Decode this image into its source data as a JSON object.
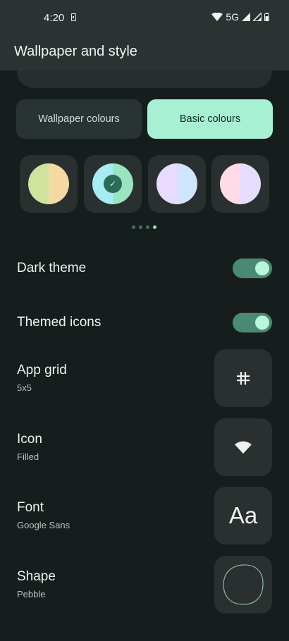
{
  "status_bar": {
    "time": "4:20",
    "network": "5G"
  },
  "header": {
    "title": "Wallpaper and style"
  },
  "tabs": [
    {
      "label": "Wallpaper colours",
      "active": false
    },
    {
      "label": "Basic colours",
      "active": true
    }
  ],
  "swatches": [
    {
      "left": "#cfe39f",
      "right": "#f6d9a2",
      "selected": false
    },
    {
      "left": "#a6ecf2",
      "right": "#98e5bf",
      "selected": true
    },
    {
      "left": "#e7dbff",
      "right": "#cfe4ff",
      "selected": false
    },
    {
      "left": "#ffdbe8",
      "right": "#e6dcff",
      "selected": false
    }
  ],
  "pager": {
    "count": 4,
    "active_index": 3
  },
  "settings": {
    "dark_theme": {
      "label": "Dark theme",
      "on": true
    },
    "themed_icons": {
      "label": "Themed icons",
      "on": true
    },
    "app_grid": {
      "label": "App grid",
      "value": "5x5",
      "icon": "grid-icon"
    },
    "icon": {
      "label": "Icon",
      "value": "Filled",
      "icon": "wifi-icon"
    },
    "font": {
      "label": "Font",
      "value": "Google Sans",
      "preview": "Aa"
    },
    "shape": {
      "label": "Shape",
      "value": "Pebble",
      "icon": "pebble-shape-icon"
    }
  },
  "colors": {
    "accent": "#a8f0d3",
    "toggle_track": "#4b8a72",
    "background": "#161d1d"
  }
}
